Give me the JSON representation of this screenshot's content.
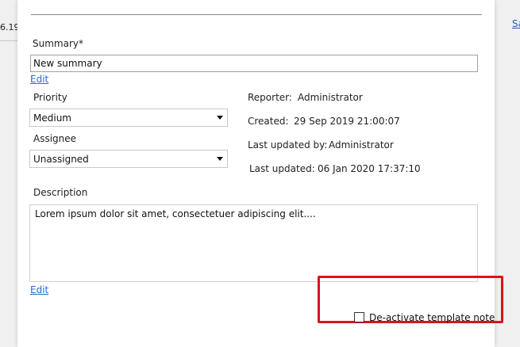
{
  "background": {
    "left_text": "6.19.",
    "right_link": "Sa"
  },
  "form": {
    "summary": {
      "label": "Summary*",
      "value": "New summary",
      "edit_link": "Edit"
    },
    "priority": {
      "label": "Priority",
      "selected": "Medium"
    },
    "assignee": {
      "label": "Assignee",
      "selected": "Unassigned"
    },
    "info": {
      "reporter_label": "Reporter:",
      "reporter_value": "Administrator",
      "created_label": "Created:",
      "created_value": "29 Sep 2019 21:00:07",
      "last_updated_by_label": "Last updated by:",
      "last_updated_by_value": "Administrator",
      "last_updated_label": "Last updated:",
      "last_updated_value": "06 Jan 2020 17:37:10"
    },
    "description": {
      "label": "Description",
      "value": "Lorem ipsum dolor sit amet, consectetuer adipiscing elit....",
      "edit_link": "Edit"
    },
    "deactivate": {
      "label": "De-activate template note",
      "checked": false
    }
  },
  "colors": {
    "link": "#2a6ad0",
    "highlight": "#d9141e"
  }
}
